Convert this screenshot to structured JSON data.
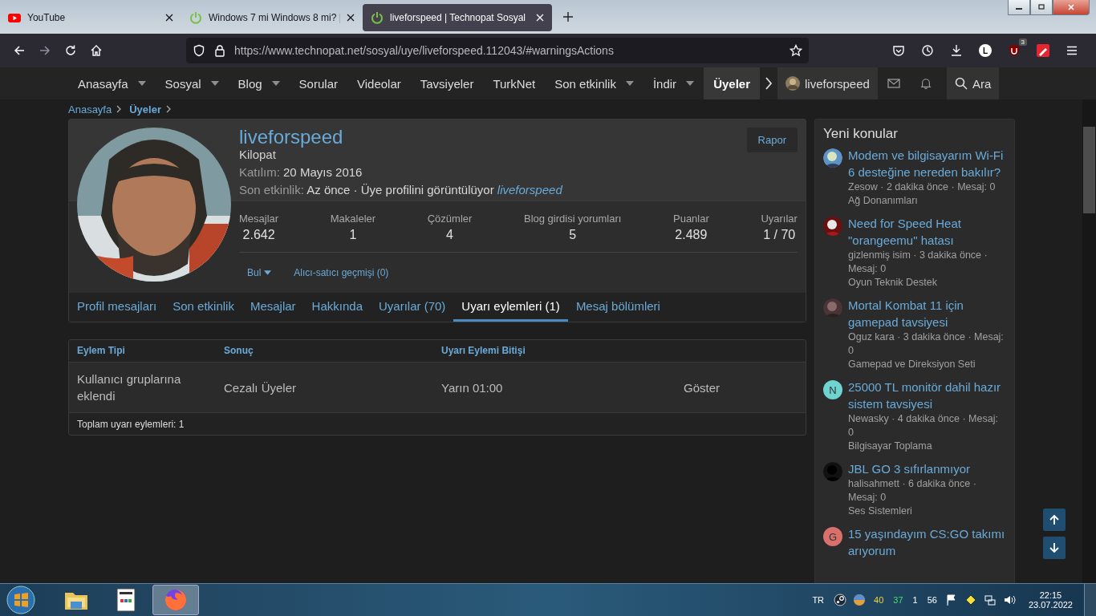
{
  "browser": {
    "tabs": [
      {
        "title": "YouTube",
        "selected": false,
        "kind": "video"
      },
      {
        "title": "Windows 7 mi Windows 8 mi? |",
        "selected": false,
        "kind": "forum"
      },
      {
        "title": "liveforspeed | Technopat Sosyal",
        "selected": true,
        "kind": "forum"
      }
    ],
    "url": "https://www.technopat.net/sosyal/uye/liveforspeed.112043/#warningsActions",
    "account_letter": "L",
    "extension_badge": "3"
  },
  "site_nav": {
    "items": [
      {
        "label": "Anasayfa",
        "dropdown": true,
        "selected": false
      },
      {
        "label": "Sosyal",
        "dropdown": true,
        "selected": false
      },
      {
        "label": "Blog",
        "dropdown": true,
        "selected": false
      },
      {
        "label": "Sorular",
        "dropdown": false,
        "selected": false
      },
      {
        "label": "Videolar",
        "dropdown": false,
        "selected": false
      },
      {
        "label": "Tavsiyeler",
        "dropdown": false,
        "selected": false
      },
      {
        "label": "TurkNet",
        "dropdown": false,
        "selected": false
      },
      {
        "label": "Son etkinlik",
        "dropdown": true,
        "selected": false
      },
      {
        "label": "İndir",
        "dropdown": true,
        "selected": false
      },
      {
        "label": "Üyeler",
        "dropdown": false,
        "selected": true
      }
    ],
    "user": "liveforspeed",
    "search": "Ara"
  },
  "breadcrumb": [
    {
      "label": "Anasayfa",
      "current": false
    },
    {
      "label": "Üyeler",
      "current": true
    }
  ],
  "profile": {
    "name": "liveforspeed",
    "title": "Kilopat",
    "joined_label": "Katılım:",
    "joined": "20 Mayıs 2016",
    "activity_label": "Son etkinlik:",
    "activity": "Az önce · Üye profilini görüntülüyor",
    "activity_link": "liveforspeed",
    "report": "Rapor",
    "stats": [
      {
        "label": "Mesajlar",
        "value": "2.642"
      },
      {
        "label": "Makaleler",
        "value": "1"
      },
      {
        "label": "Çözümler",
        "value": "4"
      },
      {
        "label": "Blog girdisi yorumları",
        "value": "5"
      },
      {
        "label": "Puanlar",
        "value": "2.489"
      },
      {
        "label": "Uyarılar",
        "value": "1 / 70"
      }
    ],
    "actions": [
      {
        "label": "Bul",
        "dropdown": true
      },
      {
        "label": "Alıcı-satıcı geçmişi (0)",
        "dropdown": false
      }
    ],
    "tabs": [
      {
        "label": "Profil mesajları",
        "selected": false
      },
      {
        "label": "Son etkinlik",
        "selected": false
      },
      {
        "label": "Mesajlar",
        "selected": false
      },
      {
        "label": "Hakkında",
        "selected": false
      },
      {
        "label": "Uyarılar (70)",
        "selected": false
      },
      {
        "label": "Uyarı eylemleri (1)",
        "selected": true
      },
      {
        "label": "Mesaj bölümleri",
        "selected": false
      }
    ]
  },
  "table": {
    "columns": [
      "Eylem Tipi",
      "Sonuç",
      "Uyarı Eylemi Bitişi"
    ],
    "rows": [
      {
        "cells": [
          "Kullanıcı gruplarına eklendi",
          "Cezalı Üyeler",
          "Yarın 01:00"
        ],
        "action": "Göster"
      }
    ],
    "footer": "Toplam uyarı eylemleri: 1"
  },
  "sidebar": {
    "title": "Yeni konular",
    "threads": [
      {
        "title": "Modem ve bilgisayarım Wi-Fi 6 desteğine nereden bakılır?",
        "meta": "Zesow · 2 dakika önce · Mesaj: 0",
        "forum": "Ağ Donanımları"
      },
      {
        "title": "Need for Speed Heat \"orangeemu\" hatası",
        "meta": "gizlenmiş isim · 3 dakika önce · Mesaj: 0",
        "forum": "Oyun Teknik Destek"
      },
      {
        "title": "Mortal Kombat 11 için gamepad tavsiyesi",
        "meta": "Oguz kara · 3 dakika önce · Mesaj: 0",
        "forum": "Gamepad ve Direksiyon Seti"
      },
      {
        "title": "25000 TL monitör dahil hazır sistem tavsiyesi",
        "meta": "Newasky · 4 dakika önce · Mesaj: 0",
        "forum": "Bilgisayar Toplama",
        "avatar": {
          "kind": "letter",
          "letter": "N",
          "color": "#6fd3cf"
        }
      },
      {
        "title": "JBL GO 3 sıfırlanmıyor",
        "meta": "halisahmett · 6 dakika önce · Mesaj: 0",
        "forum": "Ses Sistemleri"
      },
      {
        "title": "15 yaşındayım CS:GO takımı arıyorum",
        "avatar": {
          "kind": "letter",
          "letter": "G",
          "color": "#d9706c"
        }
      }
    ]
  },
  "taskbar": {
    "language": "TR",
    "tray_numbers": [
      {
        "text": "40",
        "color": "#f3d23a"
      },
      {
        "text": "37",
        "color": "#4fdc6a"
      },
      {
        "text": "1"
      },
      {
        "text": "56"
      }
    ],
    "time": "22:15",
    "date": "23.07.2022"
  }
}
